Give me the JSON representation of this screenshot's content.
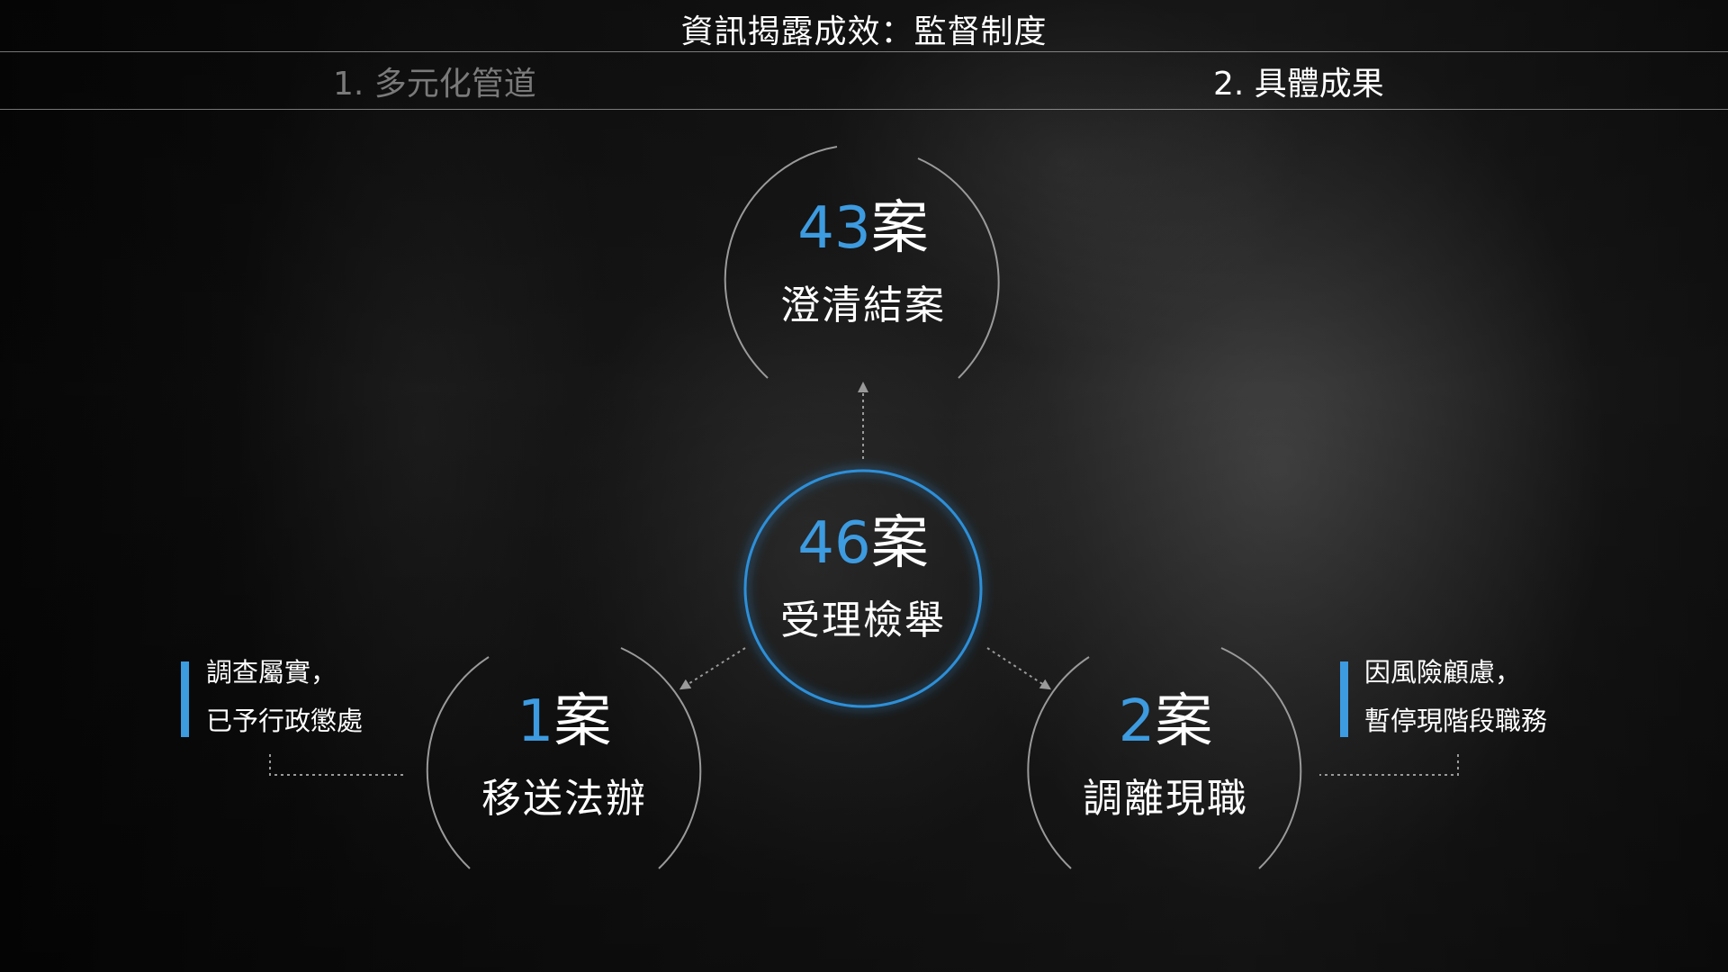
{
  "header": {
    "title": "資訊揭露成效：監督制度"
  },
  "tabs": [
    {
      "label": "1. 多元化管道",
      "active": false
    },
    {
      "label": "2. 具體成果",
      "active": true
    }
  ],
  "diagram": {
    "center": {
      "count": "46",
      "unit": "案",
      "label": "受理檢舉"
    },
    "top": {
      "count": "43",
      "unit": "案",
      "label": "澄清結案"
    },
    "left": {
      "count": "1",
      "unit": "案",
      "label": "移送法辦",
      "note": {
        "line1": "調查屬實，",
        "line2": "已予行政懲處"
      }
    },
    "right": {
      "count": "2",
      "unit": "案",
      "label": "調離現職",
      "note": {
        "line1": "因風險顧慮，",
        "line2": "暫停現階段職務"
      }
    }
  },
  "colors": {
    "accent": "#3d9be0",
    "background": "#0b0b0c",
    "text": "#ffffff",
    "inactive_tab": "#7a7a7a"
  }
}
